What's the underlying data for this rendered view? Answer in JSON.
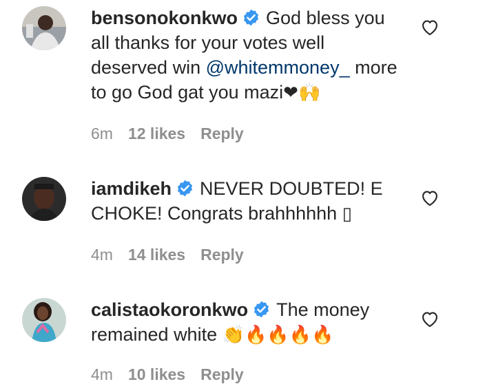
{
  "comments": [
    {
      "username": "bensonokonkwo",
      "text_before": "God bless you all thanks for your votes well deserved win ",
      "mention": "@whitemmoney_",
      "text_after": " more to go God gat you mazi",
      "emojis": "❤🙌",
      "time": "6m",
      "likes": "12 likes",
      "reply": "Reply"
    },
    {
      "username": "iamdikeh",
      "text_before": "NEVER DOUBTED! E CHOKE! Congrats brahhhhhh ",
      "mention": "",
      "text_after": "",
      "emojis": "▯",
      "time": "4m",
      "likes": "14 likes",
      "reply": "Reply"
    },
    {
      "username": "calistaokoronkwo",
      "text_before": "The money remained white ",
      "mention": "",
      "text_after": "",
      "emojis": "👏🔥🔥🔥🔥",
      "time": "4m",
      "likes": "10 likes",
      "reply": "Reply"
    }
  ],
  "colors": {
    "verified": "#3897f0",
    "mention": "#00376b",
    "meta": "#8e8e8e",
    "text": "#262626"
  },
  "icons": {
    "verified": "verified-badge-icon",
    "like": "heart-outline-icon"
  }
}
